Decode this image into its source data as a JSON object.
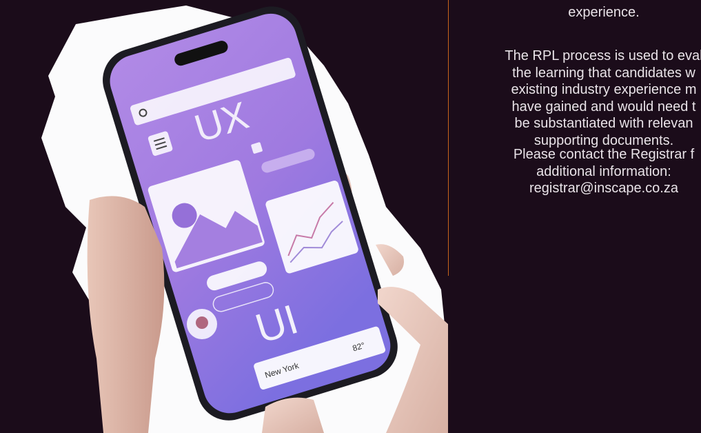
{
  "text_panel": {
    "paragraph_1": "experience.",
    "paragraph_2_lines": [
      "The RPL process is used to eval",
      "the learning that candidates w",
      "existing industry experience m",
      "have gained and would need t",
      "be substantiated with relevan",
      "supporting documents."
    ],
    "paragraph_3_lines": [
      "Please contact the Registrar f",
      "additional information:",
      "registrar@inscape.co.za"
    ]
  },
  "phone_screen": {
    "top_label": "UX",
    "bottom_label": "UI",
    "location_label": "New York",
    "temperature_label": "82°"
  },
  "colors": {
    "background": "#1b0c1a",
    "divider_accent": "#c8651b",
    "text": "#e9e3e8",
    "screen_purple": "#a77de2"
  }
}
